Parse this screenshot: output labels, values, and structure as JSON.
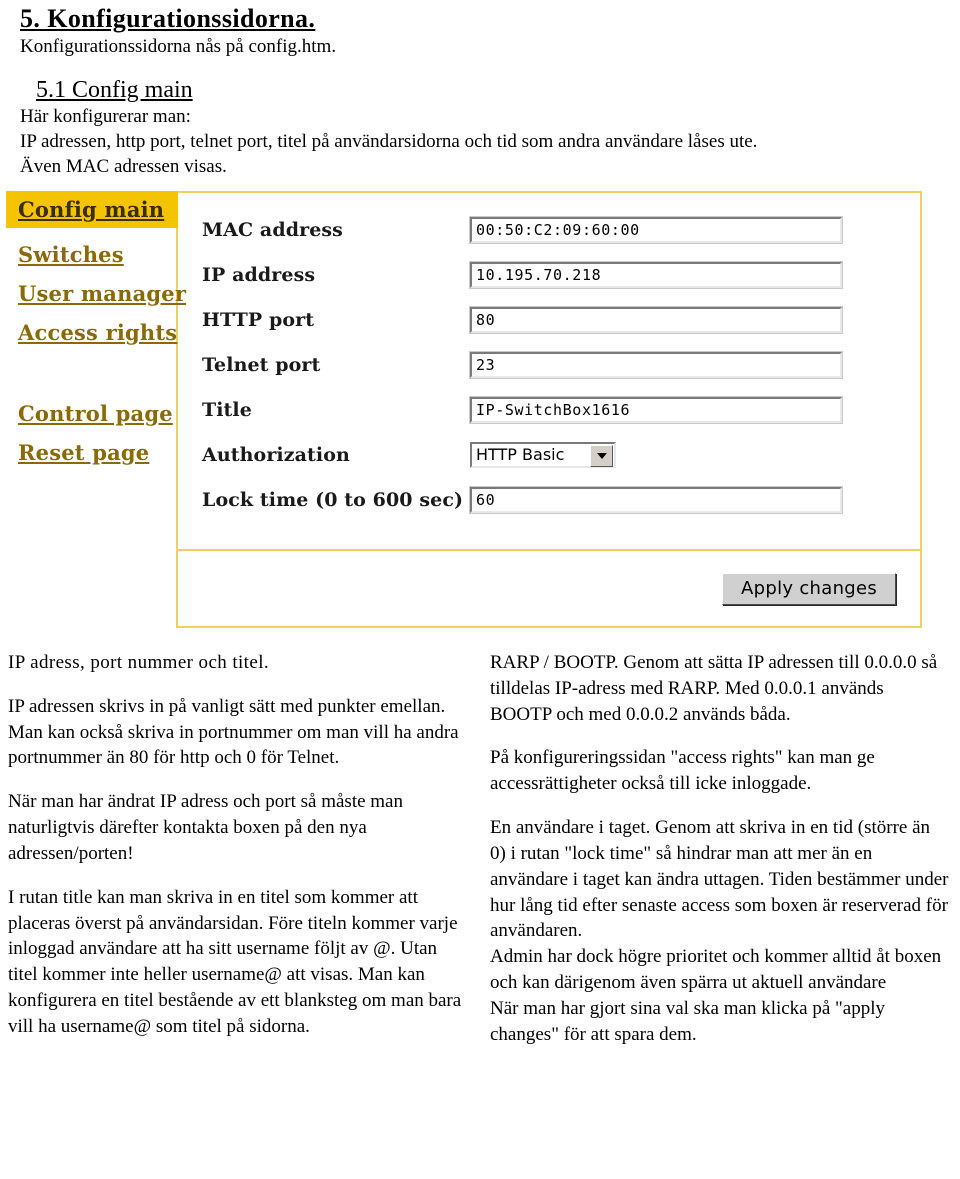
{
  "document": {
    "heading_1": "5. Konfigurationssidorna.",
    "subtitle_1": "Konfigurationssidorna nås på config.htm.",
    "heading_2": "5.1 Config main",
    "subtitle_2a": "Här konfigurerar man:",
    "subtitle_2b": "IP adressen, http port, telnet port, titel på användarsidorna och tid som andra användare låses ute.",
    "subtitle_2c": "Även MAC adressen visas."
  },
  "config_panel": {
    "accent_color": "#f5c400",
    "border_color": "#f0d061",
    "link_color": "#8a6a06",
    "sidebar": {
      "items": [
        {
          "label": "Config main",
          "active": true
        },
        {
          "label": "Switches",
          "active": false
        },
        {
          "label": "User manager",
          "active": false
        },
        {
          "label": "Access rights",
          "active": false
        },
        {
          "label": "Control page",
          "active": false
        },
        {
          "label": "Reset page",
          "active": false
        }
      ]
    },
    "fields": [
      {
        "label": "MAC address",
        "value": "00:50:C2:09:60:00",
        "type": "text"
      },
      {
        "label": "IP address",
        "value": "10.195.70.218",
        "type": "text"
      },
      {
        "label": "HTTP port",
        "value": "80",
        "type": "text"
      },
      {
        "label": "Telnet port",
        "value": "23",
        "type": "text"
      },
      {
        "label": "Title",
        "value": "IP-SwitchBox1616",
        "type": "text"
      },
      {
        "label": "Authorization",
        "value": "HTTP Basic",
        "type": "select"
      },
      {
        "label": "Lock time (0 to 600 sec)",
        "value": "60",
        "type": "text"
      }
    ],
    "apply_button": "Apply changes"
  },
  "left_column": {
    "p1": "IP adress, port nummer och titel.",
    "p2": "IP adressen skrivs in på vanligt sätt med punkter emellan. Man kan också skriva in portnummer om man vill ha andra portnummer än 80 för http och 0 för Telnet.",
    "p3": "När man har ändrat IP adress och port så måste man naturligtvis därefter kontakta boxen på den nya adressen/porten!",
    "p4": "I rutan title kan man skriva in en titel som kommer att placeras överst på användarsidan. Före titeln kommer varje inloggad användare att ha sitt username följt av @. Utan titel kommer inte heller username@ att visas. Man kan konfigurera en titel bestående av ett blanksteg om man bara vill ha username@ som titel på sidorna."
  },
  "right_column": {
    "p1": "RARP / BOOTP. Genom att sätta IP adressen till 0.0.0.0 så tilldelas IP-adress med RARP. Med 0.0.0.1 används BOOTP och med 0.0.0.2 används båda.",
    "p2": "På konfigureringssidan \"access rights\" kan man ge accessrättigheter också till icke inloggade.",
    "p3": "En användare i taget. Genom att skriva in en tid (större än 0) i rutan \"lock time\" så hindrar man att mer än en användare i taget kan ändra uttagen. Tiden bestämmer under hur lång tid efter senaste access som boxen är reserverad för användaren.",
    "p4": "Admin har dock högre prioritet och kommer alltid åt boxen och kan därigenom även spärra ut aktuell användare",
    "p5": "När man har gjort sina val ska man klicka på \"apply changes\" för att spara dem."
  }
}
